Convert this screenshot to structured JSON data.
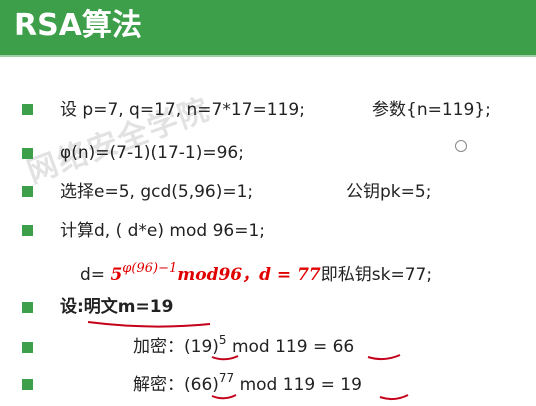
{
  "header": {
    "title": "RSA算法"
  },
  "watermark": "网络安全学院",
  "lines": {
    "l1": {
      "text": "设 p=7, q=17, n=7*17=119;",
      "param": "参数{n=119};"
    },
    "l2": {
      "text": "φ(n)=(7-1)(17-1)=96;"
    },
    "l3": {
      "text": "选择e=5, gcd(5,96)=1;",
      "pk": "公钥pk=5;"
    },
    "l4": {
      "text": "计算d, ( d*e) mod 96=1;"
    },
    "l4b": {
      "prefix": "d= ",
      "base": "5",
      "exp": "φ(96)−1",
      "mod": "mod96，",
      "d_val": "d = 77",
      "suffix": "即私钥sk=77;"
    },
    "l5": {
      "text": "设:明文m=19"
    },
    "l6": {
      "label": "加密：",
      "base": "(19)",
      "exp": "5",
      "rest": " mod 119 = ",
      "result": "66"
    },
    "l7": {
      "label": "解密：",
      "base": "(66)",
      "exp": "77",
      "rest": " mod 119 = ",
      "result": "19"
    }
  },
  "colors": {
    "header": "#3d9f49",
    "accent": "#e00000",
    "annotation": "#c4001a"
  }
}
